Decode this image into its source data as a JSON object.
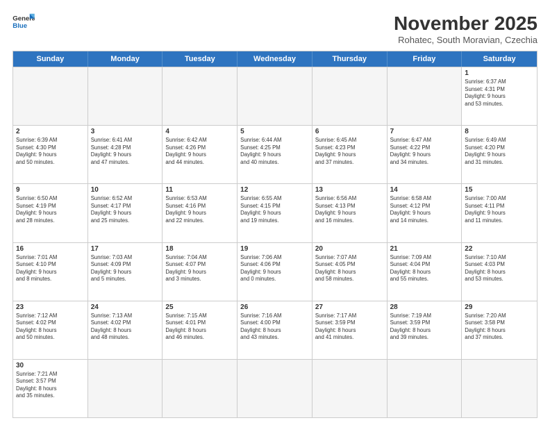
{
  "logo": {
    "line1": "General",
    "line2": "Blue"
  },
  "title": "November 2025",
  "subtitle": "Rohatec, South Moravian, Czechia",
  "header_days": [
    "Sunday",
    "Monday",
    "Tuesday",
    "Wednesday",
    "Thursday",
    "Friday",
    "Saturday"
  ],
  "weeks": [
    [
      {
        "day": "",
        "info": ""
      },
      {
        "day": "",
        "info": ""
      },
      {
        "day": "",
        "info": ""
      },
      {
        "day": "",
        "info": ""
      },
      {
        "day": "",
        "info": ""
      },
      {
        "day": "",
        "info": ""
      },
      {
        "day": "1",
        "info": "Sunrise: 6:37 AM\nSunset: 4:31 PM\nDaylight: 9 hours\nand 53 minutes."
      }
    ],
    [
      {
        "day": "2",
        "info": "Sunrise: 6:39 AM\nSunset: 4:30 PM\nDaylight: 9 hours\nand 50 minutes."
      },
      {
        "day": "3",
        "info": "Sunrise: 6:41 AM\nSunset: 4:28 PM\nDaylight: 9 hours\nand 47 minutes."
      },
      {
        "day": "4",
        "info": "Sunrise: 6:42 AM\nSunset: 4:26 PM\nDaylight: 9 hours\nand 44 minutes."
      },
      {
        "day": "5",
        "info": "Sunrise: 6:44 AM\nSunset: 4:25 PM\nDaylight: 9 hours\nand 40 minutes."
      },
      {
        "day": "6",
        "info": "Sunrise: 6:45 AM\nSunset: 4:23 PM\nDaylight: 9 hours\nand 37 minutes."
      },
      {
        "day": "7",
        "info": "Sunrise: 6:47 AM\nSunset: 4:22 PM\nDaylight: 9 hours\nand 34 minutes."
      },
      {
        "day": "8",
        "info": "Sunrise: 6:49 AM\nSunset: 4:20 PM\nDaylight: 9 hours\nand 31 minutes."
      }
    ],
    [
      {
        "day": "9",
        "info": "Sunrise: 6:50 AM\nSunset: 4:19 PM\nDaylight: 9 hours\nand 28 minutes."
      },
      {
        "day": "10",
        "info": "Sunrise: 6:52 AM\nSunset: 4:17 PM\nDaylight: 9 hours\nand 25 minutes."
      },
      {
        "day": "11",
        "info": "Sunrise: 6:53 AM\nSunset: 4:16 PM\nDaylight: 9 hours\nand 22 minutes."
      },
      {
        "day": "12",
        "info": "Sunrise: 6:55 AM\nSunset: 4:15 PM\nDaylight: 9 hours\nand 19 minutes."
      },
      {
        "day": "13",
        "info": "Sunrise: 6:56 AM\nSunset: 4:13 PM\nDaylight: 9 hours\nand 16 minutes."
      },
      {
        "day": "14",
        "info": "Sunrise: 6:58 AM\nSunset: 4:12 PM\nDaylight: 9 hours\nand 14 minutes."
      },
      {
        "day": "15",
        "info": "Sunrise: 7:00 AM\nSunset: 4:11 PM\nDaylight: 9 hours\nand 11 minutes."
      }
    ],
    [
      {
        "day": "16",
        "info": "Sunrise: 7:01 AM\nSunset: 4:10 PM\nDaylight: 9 hours\nand 8 minutes."
      },
      {
        "day": "17",
        "info": "Sunrise: 7:03 AM\nSunset: 4:09 PM\nDaylight: 9 hours\nand 5 minutes."
      },
      {
        "day": "18",
        "info": "Sunrise: 7:04 AM\nSunset: 4:07 PM\nDaylight: 9 hours\nand 3 minutes."
      },
      {
        "day": "19",
        "info": "Sunrise: 7:06 AM\nSunset: 4:06 PM\nDaylight: 9 hours\nand 0 minutes."
      },
      {
        "day": "20",
        "info": "Sunrise: 7:07 AM\nSunset: 4:05 PM\nDaylight: 8 hours\nand 58 minutes."
      },
      {
        "day": "21",
        "info": "Sunrise: 7:09 AM\nSunset: 4:04 PM\nDaylight: 8 hours\nand 55 minutes."
      },
      {
        "day": "22",
        "info": "Sunrise: 7:10 AM\nSunset: 4:03 PM\nDaylight: 8 hours\nand 53 minutes."
      }
    ],
    [
      {
        "day": "23",
        "info": "Sunrise: 7:12 AM\nSunset: 4:02 PM\nDaylight: 8 hours\nand 50 minutes."
      },
      {
        "day": "24",
        "info": "Sunrise: 7:13 AM\nSunset: 4:02 PM\nDaylight: 8 hours\nand 48 minutes."
      },
      {
        "day": "25",
        "info": "Sunrise: 7:15 AM\nSunset: 4:01 PM\nDaylight: 8 hours\nand 46 minutes."
      },
      {
        "day": "26",
        "info": "Sunrise: 7:16 AM\nSunset: 4:00 PM\nDaylight: 8 hours\nand 43 minutes."
      },
      {
        "day": "27",
        "info": "Sunrise: 7:17 AM\nSunset: 3:59 PM\nDaylight: 8 hours\nand 41 minutes."
      },
      {
        "day": "28",
        "info": "Sunrise: 7:19 AM\nSunset: 3:59 PM\nDaylight: 8 hours\nand 39 minutes."
      },
      {
        "day": "29",
        "info": "Sunrise: 7:20 AM\nSunset: 3:58 PM\nDaylight: 8 hours\nand 37 minutes."
      }
    ],
    [
      {
        "day": "30",
        "info": "Sunrise: 7:21 AM\nSunset: 3:57 PM\nDaylight: 8 hours\nand 35 minutes."
      },
      {
        "day": "",
        "info": ""
      },
      {
        "day": "",
        "info": ""
      },
      {
        "day": "",
        "info": ""
      },
      {
        "day": "",
        "info": ""
      },
      {
        "day": "",
        "info": ""
      },
      {
        "day": "",
        "info": ""
      }
    ]
  ]
}
